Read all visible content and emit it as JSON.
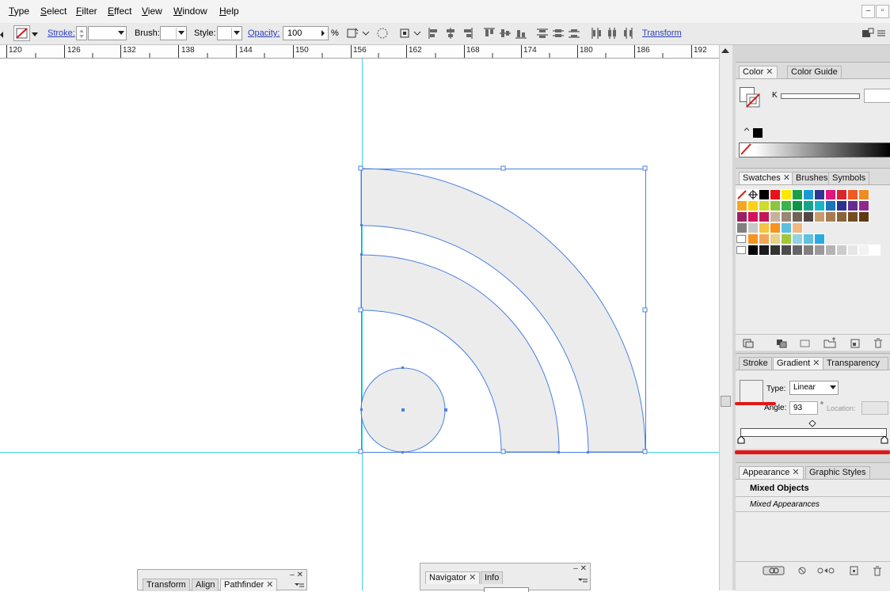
{
  "menu": {
    "items": [
      "Type",
      "Select",
      "Filter",
      "Effect",
      "View",
      "Window",
      "Help"
    ]
  },
  "window_controls": {
    "minimize": "–",
    "restore": "▫",
    "close": "x"
  },
  "control_bar": {
    "stroke_label": "Stroke:",
    "brush_label": "Brush:",
    "style_label": "Style:",
    "opacity_label": "Opacity:",
    "opacity_value": "100",
    "opacity_unit": "%",
    "transform_label": "Transform"
  },
  "ruler": {
    "labels": [
      "120",
      "126",
      "132",
      "138",
      "144",
      "150",
      "156",
      "162",
      "168",
      "174",
      "180",
      "186",
      "192"
    ]
  },
  "color_panel": {
    "tabs": [
      {
        "label": "Color",
        "active": true,
        "closable": true
      },
      {
        "label": "Color Guide",
        "active": false,
        "closable": false
      }
    ],
    "channel_label": "K"
  },
  "swatches_panel": {
    "tabs": [
      {
        "label": "Swatches",
        "active": true,
        "closable": true
      },
      {
        "label": "Brushes",
        "active": false
      },
      {
        "label": "Symbols",
        "active": false
      }
    ],
    "rows": [
      [
        "#ffffff",
        "#ffffff",
        "#000000",
        "#e8141b",
        "#fbe900",
        "#1aa049",
        "#1d9ad6",
        "#2f3590",
        "#e4157d",
        "#d9262a",
        "#ee5a24",
        "#f18b21"
      ],
      [
        "#f6a722",
        "#fcd116",
        "#cfdc28",
        "#8cc63f",
        "#38b44a",
        "#0e9447",
        "#17a28e",
        "#1ab6c6",
        "#1b75bb",
        "#2e3192",
        "#662d91",
        "#92278f"
      ],
      [
        "#9e1f63",
        "#d4145a",
        "#c2185b",
        "#c7b299",
        "#998675",
        "#736357",
        "#534741",
        "#c69c6d",
        "#a67c52",
        "#8c6239",
        "#754c24",
        "#603913"
      ],
      [
        "#808080",
        "#c8c8c8",
        "#f4c542",
        "#f7931e",
        "#5bc0de",
        "#f2b880"
      ],
      [
        "#f7931e",
        "#f2a65a",
        "#e4d18a",
        "#a2c839",
        "#92d3e3",
        "#61c1e0",
        "#29abe2"
      ],
      [
        "#000000",
        "#1a1a1a",
        "#333333",
        "#4d4d4d",
        "#666666",
        "#808080",
        "#999999",
        "#b3b3b3",
        "#cccccc",
        "#e6e6e6",
        "#f2f2f2",
        "#ffffff"
      ]
    ]
  },
  "gradient_panel": {
    "tabs": [
      {
        "label": "Stroke",
        "active": false
      },
      {
        "label": "Gradient",
        "active": true,
        "closable": true
      },
      {
        "label": "Transparency",
        "active": false
      }
    ],
    "type_label": "Type:",
    "type_value": "Linear",
    "angle_label": "Angle:",
    "angle_value": "93",
    "angle_unit": "°",
    "location_label": "Location:"
  },
  "appearance_panel": {
    "tabs": [
      {
        "label": "Appearance",
        "active": true,
        "closable": true
      },
      {
        "label": "Graphic Styles",
        "active": false
      }
    ],
    "title": "Mixed Objects",
    "subtitle": "Mixed Appearances"
  },
  "pathfinder_panel": {
    "tabs": [
      {
        "label": "Transform",
        "active": false
      },
      {
        "label": "Align",
        "active": false
      },
      {
        "label": "Pathfinder",
        "active": true,
        "closable": true
      }
    ]
  },
  "navigator_panel": {
    "tabs": [
      {
        "label": "Navigator",
        "active": true,
        "closable": true
      },
      {
        "label": "Info",
        "active": false
      }
    ]
  },
  "colors": {
    "selection": "#4a7fe0",
    "guide": "#3fd2e6",
    "shape_fill": "#ececed",
    "annotation": "#e01818"
  }
}
